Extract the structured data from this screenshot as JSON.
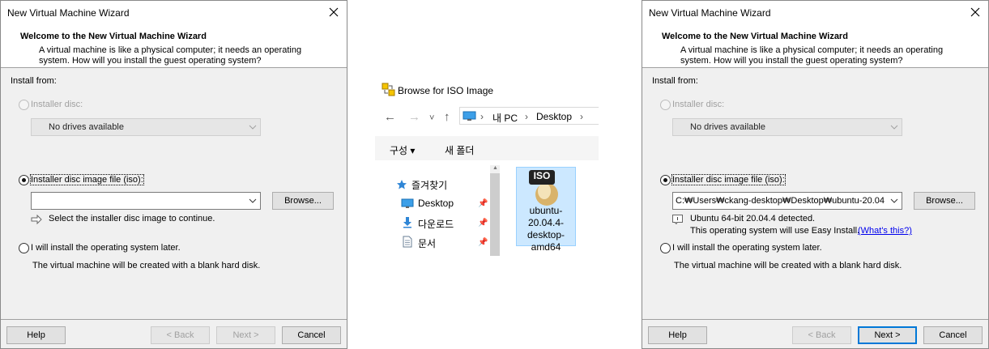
{
  "left_dialog": {
    "title": "New Virtual Machine Wizard",
    "heading": "Welcome to the New Virtual Machine Wizard",
    "description": "A virtual machine is like a physical computer; it needs an operating system. How will you install the guest operating system?",
    "install_from": "Install from:",
    "option_disc": "Installer disc:",
    "disc_value": "No drives available",
    "option_iso": "Installer disc image file (iso):",
    "iso_value": "",
    "browse": "Browse...",
    "hint": "Select the installer disc image to continue.",
    "option_later": "I will install the operating system later.",
    "later_note": "The virtual machine will be created with a blank hard disk.",
    "buttons": {
      "help": "Help",
      "back": "< Back",
      "next": "Next >",
      "cancel": "Cancel"
    }
  },
  "explorer": {
    "title": "Browse for ISO Image",
    "breadcrumb": [
      "내 PC",
      "Desktop"
    ],
    "toolbar": {
      "organize": "구성 ▾",
      "new_folder": "새 폴더"
    },
    "tree": [
      {
        "label": "즐겨찾기",
        "icon": "star-icon"
      },
      {
        "label": "Desktop",
        "icon": "desktop-icon"
      },
      {
        "label": "다운로드",
        "icon": "download-icon"
      },
      {
        "label": "문서",
        "icon": "document-icon"
      }
    ],
    "file": {
      "badge": "ISO",
      "name": "ubuntu-20.04.4-desktop-amd64"
    }
  },
  "right_dialog": {
    "title": "New Virtual Machine Wizard",
    "heading": "Welcome to the New Virtual Machine Wizard",
    "description": "A virtual machine is like a physical computer; it needs an operating system. How will you install the guest operating system?",
    "install_from": "Install from:",
    "option_disc": "Installer disc:",
    "disc_value": "No drives available",
    "option_iso": "Installer disc image file (iso):",
    "iso_value": "C:₩Users₩ckang-desktop₩Desktop₩ubuntu-20.04.",
    "browse": "Browse...",
    "detected": "Ubuntu 64-bit 20.04.4 detected.",
    "easy_install": "This operating system will use Easy Install.",
    "whats_this": "(What's this?)",
    "option_later": "I will install the operating system later.",
    "later_note": "The virtual machine will be created with a blank hard disk.",
    "buttons": {
      "help": "Help",
      "back": "< Back",
      "next": "Next >",
      "cancel": "Cancel"
    }
  },
  "colors": {
    "accent": "#0078d7",
    "file_selected": "#cce8ff",
    "link": "#0000ee"
  }
}
